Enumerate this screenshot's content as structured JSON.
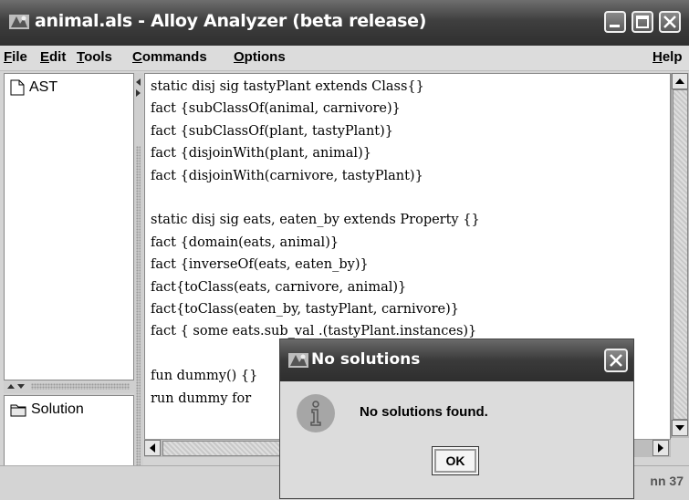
{
  "window": {
    "title": "animal.als - Alloy Analyzer (beta release)"
  },
  "menu": {
    "file": "File",
    "edit": "Edit",
    "tools": "Tools",
    "commands": "Commands",
    "options": "Options",
    "help": "Help"
  },
  "tree": {
    "top_item": "AST",
    "bottom_item": "Solution"
  },
  "editor": {
    "lines": [
      "static disj sig tastyPlant extends Class{}",
      "fact {subClassOf(animal, carnivore)}",
      "fact {subClassOf(plant, tastyPlant)}",
      "fact {disjoinWith(plant, animal)}",
      "fact {disjoinWith(carnivore, tastyPlant)}",
      "",
      "static disj sig eats, eaten_by extends Property {}",
      "fact {domain(eats, animal)}",
      "fact {inverseOf(eats, eaten_by)}",
      "fact{toClass(eats, carnivore, animal)}",
      "fact{toClass(eaten_by, tastyPlant, carnivore)}",
      "fact { some eats.sub_val .(tastyPlant.instances)}",
      "",
      "fun dummy() {}",
      "run dummy for"
    ]
  },
  "status": {
    "text": "nn 37"
  },
  "dialog": {
    "title": "No solutions",
    "message": "No solutions found.",
    "ok_label": "OK"
  }
}
